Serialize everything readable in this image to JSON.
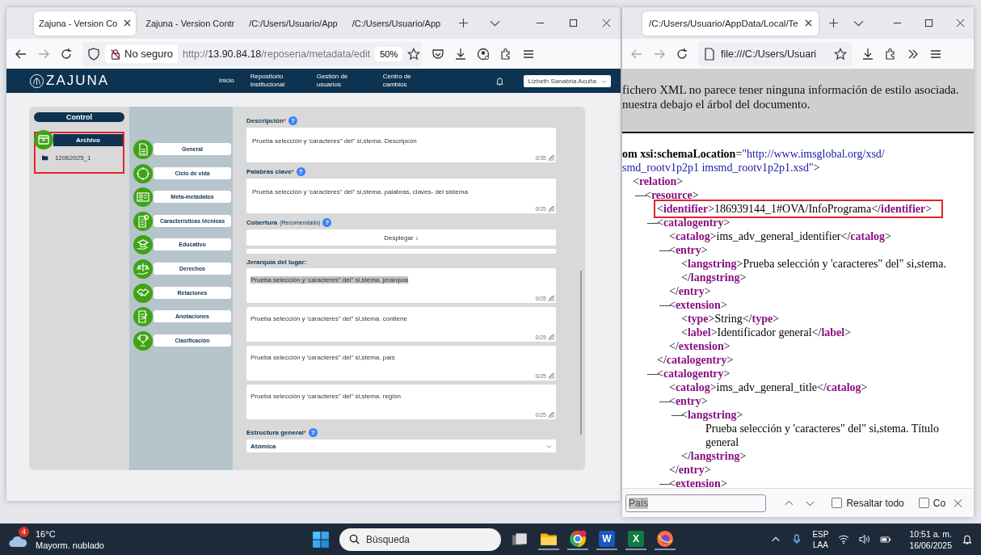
{
  "browser_left": {
    "tabs": [
      {
        "label": "Zajuna - Version Co",
        "selected": true
      },
      {
        "label": "Zajuna - Version Contr",
        "selected": false
      },
      {
        "label": "/C:/Users/Usuario/App",
        "selected": false
      },
      {
        "label": "/C:/Users/Usuario/App",
        "selected": false
      }
    ],
    "address": {
      "security": "No seguro",
      "scheme": "http://",
      "host": "13.90.84.18",
      "path": "/reposena/metadata/edit",
      "zoom": "50%"
    }
  },
  "app": {
    "logo": "ZAJUNA",
    "nav": [
      "Inicio",
      "Repositorio Institucional",
      "Gestión de usuarios",
      "Centro de cambios"
    ],
    "user": "Lizbeth Sanabria Acuña"
  },
  "control": {
    "title": "Control",
    "folder": "Archivo",
    "items": [
      "12062025_1"
    ]
  },
  "sections": [
    {
      "label": "General",
      "kind": "document"
    },
    {
      "label": "Ciclo de vida",
      "kind": "cycle"
    },
    {
      "label": "Meta-metadatos",
      "kind": "card"
    },
    {
      "label": "Características técnicas",
      "kind": "specs"
    },
    {
      "label": "Educativo",
      "kind": "education"
    },
    {
      "label": "Derechos",
      "kind": "scales"
    },
    {
      "label": "Relaciones",
      "kind": "handshake"
    },
    {
      "label": "Anotaciones",
      "kind": "notes"
    },
    {
      "label": "Clasificación",
      "kind": "trophy"
    }
  ],
  "form": {
    "required_mark": "*",
    "fields": [
      {
        "kind": "textarea",
        "label": "Descripción",
        "required": true,
        "help": "?",
        "value": "Prueba selección y 'caracteres\" del\" si,stema. Descripcón",
        "counter": "0/35"
      },
      {
        "kind": "textarea",
        "label": "Palabras clave",
        "required": true,
        "help": "?",
        "value": "Prueba selección y 'caracteres\" del\" si,stema. palabras, claves- del sistema",
        "counter": "0/25"
      },
      {
        "kind": "expander",
        "label": "Cobertura",
        "note": "(Recomendado)",
        "required": false,
        "help": "?",
        "button": "Desplegar ↓"
      },
      {
        "kind": "group",
        "label": "Jerarquía del lugar:",
        "required": false,
        "items": [
          {
            "value": "Prueba selección y 'caracteres\" del\" si,stema. jerarquía",
            "counter": "0/25",
            "selected": true
          },
          {
            "value": "Prueba selección y 'caracteres\" del\" si,stema. contiene",
            "counter": "0/25",
            "selected": false
          },
          {
            "value": "Prueba selección y 'caracteres\" del\" si,stema. país",
            "counter": "0/25",
            "selected": false
          },
          {
            "value": "Prueba selección y 'caracteres\" del\" si,stema. región",
            "counter": "0/25",
            "selected": false
          }
        ]
      },
      {
        "kind": "select",
        "label": "Estructura general",
        "required": true,
        "help": "?",
        "value": "Atómica"
      }
    ]
  },
  "browser_right": {
    "tabs": [
      {
        "label": "/C:/Users/Usuario/AppData/Local/Te",
        "selected": true
      }
    ],
    "address": "file:///C:/Users/Usuari"
  },
  "xml_viewer": {
    "notice": [
      "fichero XML no parece tener ninguna información de estilo asociada.",
      "nuestra debajo el árbol del documento."
    ],
    "syntax": {
      "open": "<",
      "close": ">",
      "end": "</",
      "toggle": "—"
    },
    "head": {
      "attr": "om xsi:schemaLocation",
      "eq": "=",
      "value": [
        "\"http://www.imsglobal.org/xsd/",
        "smd_rootv1p2p1 imsmd_rootv1p2p1.xsd\""
      ],
      "close": ">"
    },
    "tree": [
      {
        "kind": "block",
        "tag": "relation",
        "children": [
          {
            "kind": "block",
            "tag": "resource",
            "collapsible": true,
            "children": [
              {
                "kind": "inline",
                "tag": "identifier",
                "text": "186939144_1#OVA/InfoPrograma",
                "end_tag": "identifier",
                "highlighted": true
              },
              {
                "kind": "block",
                "tag": "catalogentry",
                "collapsible": true,
                "end_tag": "catalogentry",
                "children": [
                  {
                    "kind": "inline",
                    "tag": "catalog",
                    "text": "ims_adv_general_identifier",
                    "end_tag": "catalog",
                    "highlighted": false
                  },
                  {
                    "kind": "block",
                    "tag": "entry",
                    "collapsible": true,
                    "end_tag": "entry",
                    "children": [
                      {
                        "kind": "inline",
                        "tag": "langstring",
                        "text": "Prueba selección y 'caracteres\" del\" si,stema.",
                        "end_tag": "langstring",
                        "highlighted": false
                      }
                    ]
                  },
                  {
                    "kind": "block",
                    "tag": "extension",
                    "collapsible": true,
                    "end_tag": "extension",
                    "children": [
                      {
                        "kind": "inline",
                        "tag": "type",
                        "text": "String",
                        "end_tag": "type",
                        "highlighted": false
                      },
                      {
                        "kind": "inline",
                        "tag": "label",
                        "text": "Identificador general",
                        "end_tag": "label",
                        "highlighted": false
                      }
                    ]
                  }
                ]
              },
              {
                "kind": "block",
                "tag": "catalogentry",
                "collapsible": true,
                "children": [
                  {
                    "kind": "inline",
                    "tag": "catalog",
                    "text": "ims_adv_general_title",
                    "end_tag": "catalog",
                    "highlighted": false
                  },
                  {
                    "kind": "block",
                    "tag": "entry",
                    "collapsible": true,
                    "end_tag": "entry",
                    "children": [
                      {
                        "kind": "block",
                        "tag": "langstring",
                        "collapsible": true,
                        "text": "Prueba selección y 'caracteres\" del\" si,stema. Título general",
                        "end_tag": "langstring"
                      }
                    ]
                  },
                  {
                    "kind": "block",
                    "tag": "extension",
                    "collapsible": true
                  }
                ]
              }
            ]
          }
        ]
      }
    ]
  },
  "find_bar": {
    "value": "País",
    "selected": true,
    "options": [
      {
        "label": "Resaltar todo",
        "checked": false
      },
      {
        "label": "Co",
        "checked": false
      }
    ]
  },
  "taskbar": {
    "weather": {
      "badge": "4",
      "temp": "16°C",
      "desc": "Mayorm. nublado"
    },
    "search": "Búsqueda",
    "apps": [
      {
        "kind": "start",
        "running": false
      },
      {
        "kind": "task-view",
        "running": false
      },
      {
        "kind": "folder",
        "running": true
      },
      {
        "kind": "chrome",
        "running": true,
        "badge": true
      },
      {
        "kind": "word",
        "letter": "W",
        "running": true
      },
      {
        "kind": "excel",
        "letter": "X",
        "running": true
      },
      {
        "kind": "firefox",
        "running": true
      }
    ],
    "language": [
      "ESP",
      "LAA"
    ],
    "time": "10:51 a. m.",
    "date": "16/06/2025"
  }
}
